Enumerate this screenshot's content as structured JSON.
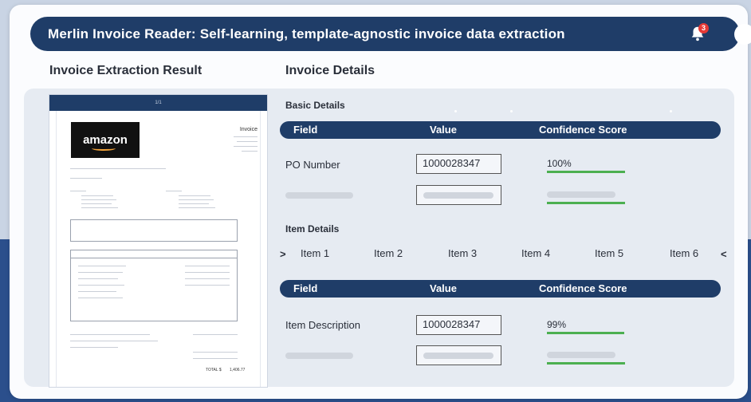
{
  "header": {
    "title": "Merlin Invoice Reader: Self-learning, template-agnostic invoice data extraction",
    "notification_count": "3"
  },
  "sections": {
    "extraction_result": "Invoice Extraction Result",
    "invoice_details": "Invoice Details"
  },
  "document": {
    "page_indicator": "1/1",
    "logo_text": "amazon",
    "invoice_label": "Invoice",
    "total_label": "TOTAL $",
    "total_value": "1,406.77"
  },
  "basic_details": {
    "title": "Basic Details",
    "columns": [
      "Field",
      "Value",
      "Confidence Score"
    ],
    "rows": [
      {
        "field": "PO Number",
        "value": "1000028347",
        "score": "100%",
        "score_fraction": 1.0
      }
    ]
  },
  "item_details": {
    "title": "Item Details",
    "tabs": [
      "Item 1",
      "Item 2",
      "Item 3",
      "Item 4",
      "Item 5",
      "Item 6"
    ],
    "columns": [
      "Field",
      "Value",
      "Confidence Score"
    ],
    "rows": [
      {
        "field": "Item Description",
        "value": "1000028347",
        "score": "99%",
        "score_fraction": 0.99
      }
    ]
  },
  "colors": {
    "header_bg": "#1f3d68",
    "confidence_bar": "#4caf50",
    "badge": "#e53935"
  }
}
